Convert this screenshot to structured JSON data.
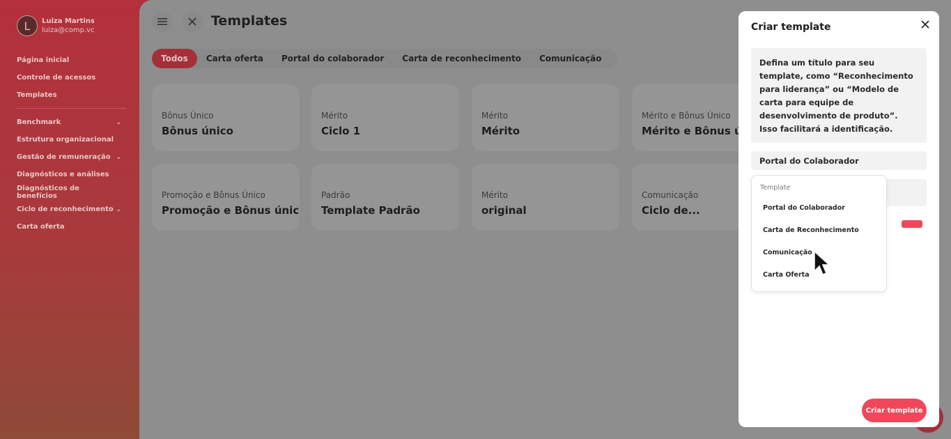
{
  "user": {
    "initial": "L",
    "name": "Luiza Martins",
    "email": "luiza@comp.vc"
  },
  "sidebar": {
    "top_items": [
      {
        "label": "Página inicial"
      },
      {
        "label": "Controle de acessos"
      },
      {
        "label": "Templates"
      }
    ],
    "items": [
      {
        "label": "Benchmark",
        "expandable": true
      },
      {
        "label": "Estrutura organizacional",
        "expandable": false
      },
      {
        "label": "Gestão de remuneração",
        "expandable": true
      },
      {
        "label": "Diagnósticos e análises",
        "expandable": false
      },
      {
        "label": "Diagnósticos de benefícios",
        "expandable": false
      },
      {
        "label": "Ciclo de reconhecimento",
        "expandable": true
      },
      {
        "label": "Carta oferta",
        "expandable": false
      }
    ]
  },
  "header": {
    "title": "Templates",
    "menu_icon": "hamburger-icon",
    "close_icon": "close-icon"
  },
  "tabs": [
    {
      "label": "Todos",
      "active": true
    },
    {
      "label": "Carta oferta",
      "active": false
    },
    {
      "label": "Portal do colaborador",
      "active": false
    },
    {
      "label": "Carta de reconhecimento",
      "active": false
    },
    {
      "label": "Comunicação",
      "active": false
    }
  ],
  "cards": [
    {
      "category": "Bônus Único",
      "title": "Bônus único"
    },
    {
      "category": "Mérito",
      "title": "Ciclo 1"
    },
    {
      "category": "Mérito",
      "title": "Mérito"
    },
    {
      "category": "Mérito e Bônus Único",
      "title": "Mérito e Bônus único"
    },
    {
      "category": "Promoção e Bônus Único",
      "title": "Promoção e Bônus único"
    },
    {
      "category": "Padrão",
      "title": "Template Padrão"
    },
    {
      "category": "Mérito",
      "title": "original"
    },
    {
      "category": "Comunicação",
      "title": "Ciclo de..."
    }
  ],
  "modal": {
    "title": "Criar template",
    "info": "Defina um título para seu template, como “Reconhecimento para liderança” ou “Modelo de carta para equipe de desenvolvimento de produto”. Isso facilitará a identificação.",
    "selected_type": "Portal do Colaborador",
    "dropdown": {
      "label": "Template",
      "options": [
        "Portal do Colaborador",
        "Carta de Reconhecimento",
        "Comunicação",
        "Carta Oferta"
      ]
    },
    "submit_label": "Criar template"
  },
  "colors": {
    "accent": "#f0485a",
    "sidebar": "#b3303c"
  }
}
